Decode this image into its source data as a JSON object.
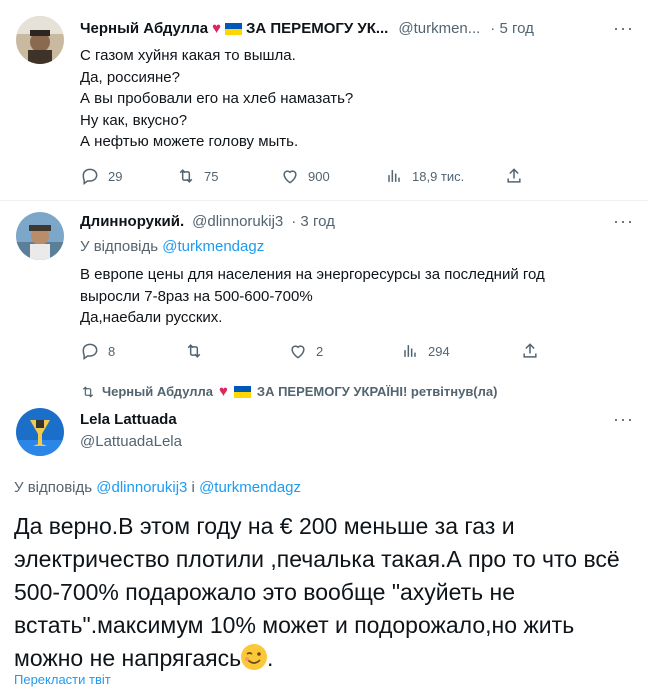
{
  "tweet1": {
    "display_name": "Черный Абдулла",
    "name_suffix": "ЗА ПЕРЕМОГУ УК...",
    "handle": "@turkmen...",
    "time": "· 5 год",
    "more": "···",
    "lines": [
      "С газом хуйня какая то вышла.",
      "Да, россияне?",
      "А вы пробовали его на хлеб намазать?",
      "Ну как, вкусно?",
      "А нефтью можете голову мыть."
    ],
    "stats": {
      "replies": "29",
      "retweets": "75",
      "likes": "900",
      "views": "18,9 тис."
    }
  },
  "tweet2": {
    "display_name": "Длиннорукий.",
    "handle": "@dlinnorukij3",
    "time": "· 3 год",
    "more": "···",
    "reply_prefix": "У відповідь",
    "reply_to": "@turkmendagz",
    "lines": [
      "В европе цены для населения на энергоресурсы за последний год",
      "выросли 7-8раз на 500-600-700%",
      "Да,наебали русских."
    ],
    "stats": {
      "replies": "8",
      "retweets": "",
      "likes": "2",
      "views": "294"
    }
  },
  "retweet_banner": {
    "name": "Черный Абдулла",
    "suffix": "ЗА ПЕРЕМОГУ УКРАЇНІ! ретвітнув(ла)"
  },
  "tweet3": {
    "display_name": "Lela Lattuada",
    "handle": "@LattuadaLela",
    "more": "···",
    "reply_prefix": "У відповідь",
    "reply_to_1": "@dlinnorukij3",
    "reply_joiner": "і",
    "reply_to_2": "@turkmendagz",
    "text": "Да верно.В этом году на € 200 меньше за газ и электричество плотили ,печалька такая.А про то что всё 500-700% подарожало это вообще  \"ахуйеть не встать\".максимум 10% может и подорожало,но жить можно не напрягаясь",
    "text_end": ".",
    "translate": "Перекласти твіт"
  },
  "colors": {
    "link": "#1d9bf0",
    "muted": "#536471",
    "heart": "#e0245e"
  }
}
